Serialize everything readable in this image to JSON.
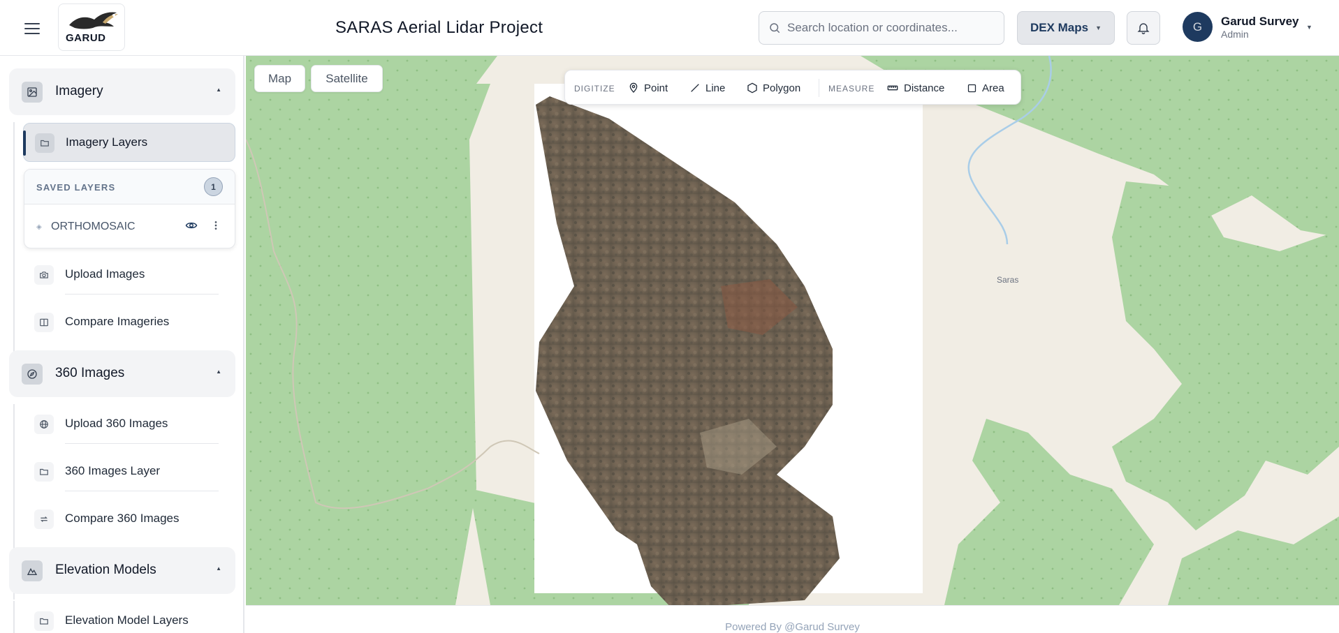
{
  "header": {
    "logo_text": "GARUD",
    "title": "SARAS Aerial Lidar Project",
    "search_placeholder": "Search location or coordinates...",
    "maps_dropdown": "DEX Maps",
    "avatar_initial": "G",
    "user_name": "Garud Survey",
    "user_role": "Admin"
  },
  "sidebar": {
    "imagery": {
      "label": "Imagery",
      "items": [
        {
          "label": "Imagery Layers",
          "active": true
        },
        {
          "label": "Upload Images"
        },
        {
          "label": "Compare Imageries"
        }
      ],
      "saved_layers": {
        "title": "SAVED LAYERS",
        "count": "1",
        "layers": [
          {
            "name": "ORTHOMOSAIC"
          }
        ]
      }
    },
    "images360": {
      "label": "360 Images",
      "items": [
        {
          "label": "Upload 360 Images"
        },
        {
          "label": "360 Images Layer"
        },
        {
          "label": "Compare 360 Images"
        }
      ]
    },
    "elevation": {
      "label": "Elevation Models",
      "items": [
        {
          "label": "Elevation Model Layers"
        }
      ]
    }
  },
  "map": {
    "type_buttons": [
      "Map",
      "Satellite"
    ],
    "digitize_label": "DIGITIZE",
    "measure_label": "MEASURE",
    "tools": {
      "point": "Point",
      "line": "Line",
      "polygon": "Polygon",
      "distance": "Distance",
      "area": "Area"
    },
    "place_label": "Saras"
  },
  "footer": {
    "text": "Powered By @Garud Survey"
  },
  "colors": {
    "primary": "#1e3a5f",
    "map_green": "#acd4a2",
    "map_land": "#f1ede4"
  }
}
